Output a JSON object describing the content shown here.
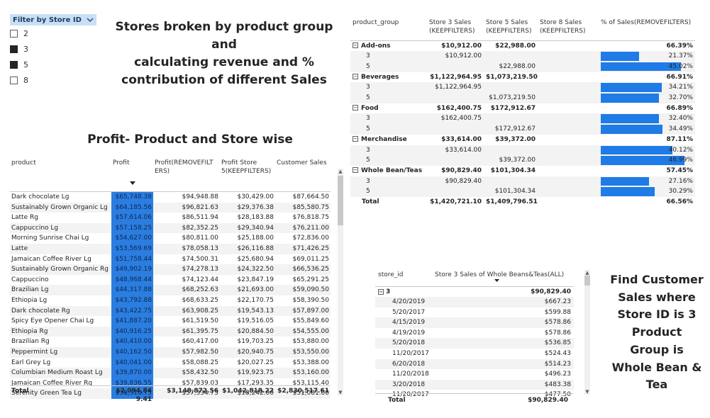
{
  "slicer": {
    "title": "Filter by Store ID",
    "items": [
      {
        "label": "2",
        "checked": false
      },
      {
        "label": "3",
        "checked": true
      },
      {
        "label": "5",
        "checked": true
      },
      {
        "label": "8",
        "checked": false
      }
    ]
  },
  "titles": {
    "main_line1": "Stores broken by product group and",
    "main_line2": "calculating revenue and %",
    "main_line3": "contribution of different Sales",
    "profit": "Profit- Product and Store wise",
    "find_lines": [
      "Find Customer",
      "Sales where",
      "Store ID is 3",
      "Product",
      "Group is",
      "Whole Bean &",
      "Tea"
    ]
  },
  "product_table": {
    "headers": [
      "product",
      "Profit",
      "Profit(REMOVEFILT ERS)",
      "Profit Store 5(KEEPFILTERS)",
      "Customer Sales"
    ],
    "rows": [
      [
        "Dark chocolate Lg",
        "$65,748.38",
        "$94,948.88",
        "$30,429.00",
        "$87,664.50"
      ],
      [
        "Sustainably Grown Organic Lg",
        "$64,185.56",
        "$96,821.63",
        "$29,376.38",
        "$85,580.75"
      ],
      [
        "Latte Rg",
        "$57,614.06",
        "$86,511.94",
        "$28,183.88",
        "$76,818.75"
      ],
      [
        "Cappuccino Lg",
        "$57,158.25",
        "$82,352.25",
        "$29,340.94",
        "$76,211.00"
      ],
      [
        "Morning Sunrise Chai Lg",
        "$54,627.00",
        "$80,811.00",
        "$25,188.00",
        "$72,836.00"
      ],
      [
        "Latte",
        "$53,569.69",
        "$78,058.13",
        "$26,116.88",
        "$71,426.25"
      ],
      [
        "Jamaican Coffee River Lg",
        "$51,758.44",
        "$74,500.31",
        "$25,680.94",
        "$69,011.25"
      ],
      [
        "Sustainably Grown Organic Rg",
        "$49,902.19",
        "$74,278.13",
        "$24,322.50",
        "$66,536.25"
      ],
      [
        "Cappuccino",
        "$48,968.44",
        "$74,123.44",
        "$23,847.19",
        "$65,291.25"
      ],
      [
        "Brazilian Lg",
        "$44,317.88",
        "$68,252.63",
        "$21,693.00",
        "$59,090.50"
      ],
      [
        "Ethiopia Lg",
        "$43,792.88",
        "$68,633.25",
        "$22,170.75",
        "$58,390.50"
      ],
      [
        "Dark chocolate Rg",
        "$43,422.75",
        "$63,908.25",
        "$19,543.13",
        "$57,897.00"
      ],
      [
        "Spicy Eye Opener Chai Lg",
        "$41,887.20",
        "$61,519.50",
        "$19,516.05",
        "$55,849.60"
      ],
      [
        "Ethiopia Rg",
        "$40,916.25",
        "$61,395.75",
        "$20,884.50",
        "$54,555.00"
      ],
      [
        "Brazilian Rg",
        "$40,410.00",
        "$60,417.00",
        "$19,703.25",
        "$53,880.00"
      ],
      [
        "Peppermint Lg",
        "$40,162.50",
        "$57,982.50",
        "$20,940.75",
        "$53,550.00"
      ],
      [
        "Earl Grey Lg",
        "$40,041.00",
        "$58,088.25",
        "$20,027.25",
        "$53,388.00"
      ],
      [
        "Columbian Medium Roast Lg",
        "$39,870.00",
        "$58,432.50",
        "$19,923.75",
        "$53,160.00"
      ],
      [
        "Jamaican Coffee River Rg",
        "$39,836.55",
        "$57,839.03",
        "$17,293.35",
        "$53,115.40"
      ],
      [
        "Serenity Green Tea Lg",
        "$38,310.75",
        "$57,334.75",
        "$18,242.00",
        "$51,081.00"
      ]
    ],
    "total": [
      "Total",
      "$2,094,849.41",
      "$3,148,872.56",
      "$1,042,818.22",
      "$2,830,517.61"
    ]
  },
  "group_table": {
    "headers": [
      "product_group",
      "Store 3 Sales (KEEPFILTERS)",
      "Store 5 Sales (KEEPFILTERS)",
      "Store 8 Sales (KEEPFILTERS)",
      "% of Sales(REMOVEFILTERS)"
    ],
    "rows": [
      {
        "type": "group",
        "label": "Add-ons",
        "s3": "$10,912.00",
        "s5": "$22,988.00",
        "s8": "",
        "pct": "66.39%",
        "bar": 0
      },
      {
        "type": "sub",
        "label": "3",
        "s3": "$10,912.00",
        "s5": "",
        "s8": "",
        "pct": "21.37%",
        "bar": 0.2137
      },
      {
        "type": "sub",
        "label": "5",
        "s3": "",
        "s5": "$22,988.00",
        "s8": "",
        "pct": "45.02%",
        "bar": 0.4502
      },
      {
        "type": "group",
        "label": "Beverages",
        "s3": "$1,122,964.95",
        "s5": "$1,073,219.50",
        "s8": "",
        "pct": "66.91%",
        "bar": 0
      },
      {
        "type": "sub",
        "label": "3",
        "s3": "$1,122,964.95",
        "s5": "",
        "s8": "",
        "pct": "34.21%",
        "bar": 0.3421
      },
      {
        "type": "sub",
        "label": "5",
        "s3": "",
        "s5": "$1,073,219.50",
        "s8": "",
        "pct": "32.70%",
        "bar": 0.327
      },
      {
        "type": "group",
        "label": "Food",
        "s3": "$162,400.75",
        "s5": "$172,912.67",
        "s8": "",
        "pct": "66.89%",
        "bar": 0
      },
      {
        "type": "sub",
        "label": "3",
        "s3": "$162,400.75",
        "s5": "",
        "s8": "",
        "pct": "32.40%",
        "bar": 0.324
      },
      {
        "type": "sub",
        "label": "5",
        "s3": "",
        "s5": "$172,912.67",
        "s8": "",
        "pct": "34.49%",
        "bar": 0.3449
      },
      {
        "type": "group",
        "label": "Merchandise",
        "s3": "$33,614.00",
        "s5": "$39,372.00",
        "s8": "",
        "pct": "87.11%",
        "bar": 0
      },
      {
        "type": "sub",
        "label": "3",
        "s3": "$33,614.00",
        "s5": "",
        "s8": "",
        "pct": "40.12%",
        "bar": 0.4012
      },
      {
        "type": "sub",
        "label": "5",
        "s3": "",
        "s5": "$39,372.00",
        "s8": "",
        "pct": "46.99%",
        "bar": 0.4699
      },
      {
        "type": "group",
        "label": "Whole Bean/Teas",
        "s3": "$90,829.40",
        "s5": "$101,304.34",
        "s8": "",
        "pct": "57.45%",
        "bar": 0
      },
      {
        "type": "sub",
        "label": "3",
        "s3": "$90,829.40",
        "s5": "",
        "s8": "",
        "pct": "27.16%",
        "bar": 0.2716
      },
      {
        "type": "sub",
        "label": "5",
        "s3": "",
        "s5": "$101,304.34",
        "s8": "",
        "pct": "30.29%",
        "bar": 0.3029
      },
      {
        "type": "total",
        "label": "Total",
        "s3": "$1,420,721.10",
        "s5": "$1,409,796.51",
        "s8": "",
        "pct": "66.56%",
        "bar": 0
      }
    ]
  },
  "store_table": {
    "headers": [
      "store_id",
      "Store 3 Sales of Whole Beans&Teas(ALL)"
    ],
    "group": {
      "label": "3",
      "value": "$90,829.40"
    },
    "rows": [
      [
        "4/20/2019",
        "$667.23"
      ],
      [
        "5/20/2017",
        "$599.88"
      ],
      [
        "4/15/2019",
        "$578.86"
      ],
      [
        "4/19/2019",
        "$578.86"
      ],
      [
        "5/20/2018",
        "$536.85"
      ],
      [
        "11/20/2017",
        "$524.43"
      ],
      [
        "6/20/2018",
        "$514.23"
      ],
      [
        "11/20/2018",
        "$496.23"
      ],
      [
        "3/20/2018",
        "$483.38"
      ],
      [
        "11/20/2017",
        "$477.50"
      ]
    ],
    "total": [
      "Total",
      "$90,829.40"
    ]
  },
  "colors": {
    "profit_bar": "#2b7de0",
    "pct_bar": "#1f7be6",
    "slicer_header": "#c8dff7"
  }
}
